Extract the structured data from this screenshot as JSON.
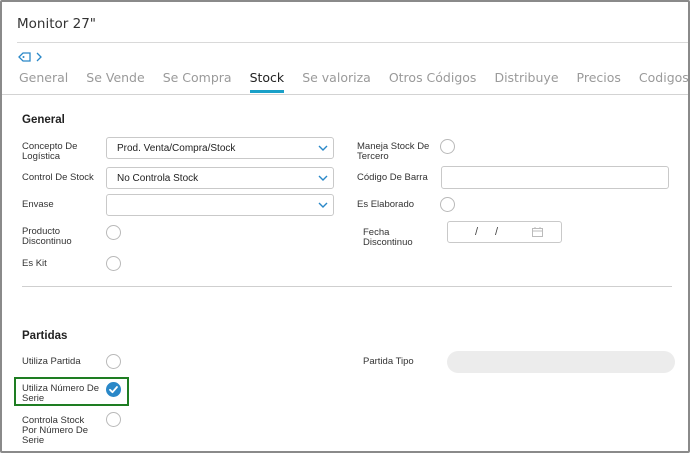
{
  "window": {
    "title": "Monitor 27\""
  },
  "tabs": [
    {
      "label": "General",
      "active": false
    },
    {
      "label": "Se Vende",
      "active": false
    },
    {
      "label": "Se Compra",
      "active": false
    },
    {
      "label": "Stock",
      "active": true
    },
    {
      "label": "Se valoriza",
      "active": false
    },
    {
      "label": "Otros Códigos",
      "active": false
    },
    {
      "label": "Distribuye",
      "active": false
    },
    {
      "label": "Precios",
      "active": false
    },
    {
      "label": "Codigos Proveedor",
      "active": false
    }
  ],
  "general": {
    "title": "General",
    "concepto_logistica": {
      "label": "Concepto De Logística",
      "value": "Prod. Venta/Compra/Stock"
    },
    "control_stock": {
      "label": "Control De Stock",
      "value": "No Controla Stock"
    },
    "envase": {
      "label": "Envase",
      "value": ""
    },
    "producto_discontinuo": {
      "label": "Producto Discontinuo",
      "checked": false
    },
    "es_kit": {
      "label": "Es Kit",
      "checked": false
    },
    "maneja_stock_tercero": {
      "label": "Maneja Stock De Tercero",
      "checked": false
    },
    "codigo_barra": {
      "label": "Código De Barra",
      "value": ""
    },
    "es_elaborado": {
      "label": "Es Elaborado",
      "checked": false
    },
    "fecha_discontinuo": {
      "label": "Fecha Discontinuo",
      "sep1": "/",
      "sep2": "/"
    }
  },
  "partidas": {
    "title": "Partidas",
    "utiliza_partida": {
      "label": "Utiliza Partida",
      "checked": false
    },
    "utiliza_numero_serie": {
      "label": "Utiliza Número De Serie",
      "checked": true
    },
    "controla_stock_serie": {
      "label": "Controla Stock Por Número De Serie",
      "checked": false
    },
    "partida_tipo": {
      "label": "Partida Tipo",
      "value": ""
    }
  },
  "colors": {
    "accent": "#2a88c8",
    "active_tab": "#1aa0c8",
    "highlight": "#1e7d22"
  },
  "icons": [
    "tag-icon",
    "chevron-right-icon",
    "chevron-down-icon",
    "calendar-icon",
    "checkmark-icon"
  ]
}
